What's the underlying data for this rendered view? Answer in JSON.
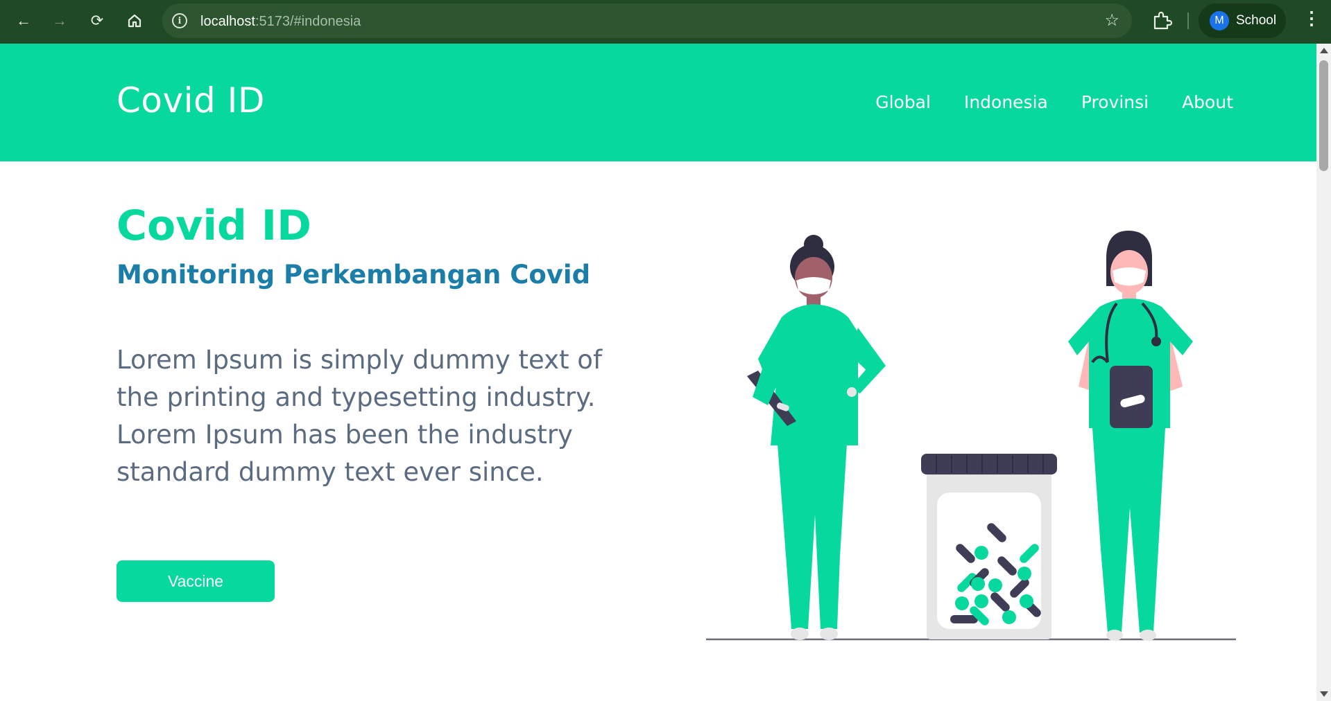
{
  "browser": {
    "url_host": "localhost",
    "url_rest": ":5173/#indonesia",
    "profile_initial": "M",
    "profile_name": "School"
  },
  "navbar": {
    "brand": "Covid ID",
    "links": [
      "Global",
      "Indonesia",
      "Provinsi",
      "About"
    ]
  },
  "hero": {
    "title": "Covid ID",
    "subtitle": "Monitoring Perkembangan Covid",
    "body": "Lorem Ipsum is simply dummy text of the printing and typesetting industry. Lorem Ipsum has been the industry standard dummy text ever since.",
    "button": "Vaccine"
  },
  "colors": {
    "brand_green": "#07d89d",
    "subtitle_blue": "#1b7ea8",
    "body_gray": "#5b6b80",
    "chrome_green": "#1f4a25"
  }
}
